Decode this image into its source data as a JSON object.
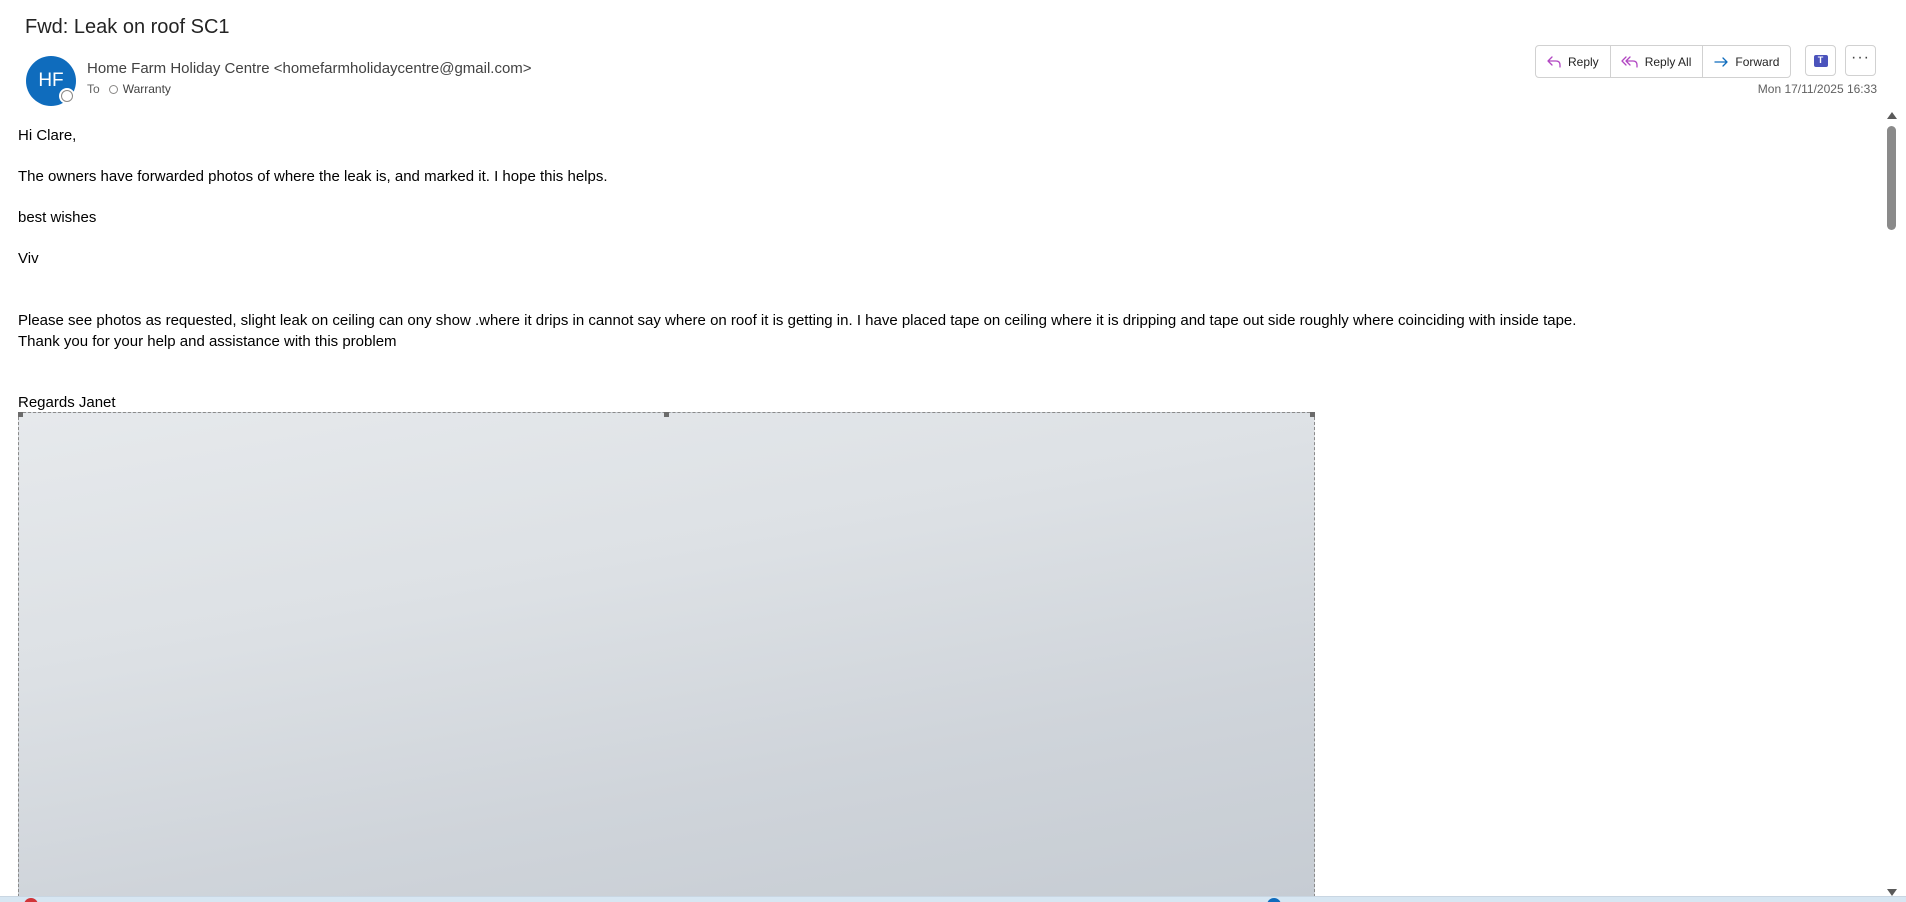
{
  "email": {
    "subject": "Fwd: Leak on roof SC1",
    "avatar_initials": "HF",
    "sender": "Home Farm Holiday Centre <homefarmholidaycentre@gmail.com>",
    "to_label": "To",
    "recipient": "Warranty",
    "date": "Mon 17/11/2025 16:33"
  },
  "actions": {
    "reply": "Reply",
    "reply_all": "Reply All",
    "forward": "Forward",
    "teams_icon": "teams-icon",
    "more_icon": "more-options-icon"
  },
  "body": {
    "greeting": "Hi Clare,",
    "line1": "The owners have forwarded photos of where the leak is, and marked it. I hope this helps.",
    "signoff": "best wishes",
    "name": "Viv",
    "forwarded_line1": "Please see photos as requested, slight leak on ceiling can ony show .where it drips in cannot say where on roof it is getting in.  I have placed tape on ceiling  where it is dripping and tape out side roughly where coinciding with inside tape.",
    "forwarded_line2": "Thank you for your help and assistance with this problem",
    "regards": "Regards Janet"
  },
  "colors": {
    "avatar": "#0f6cbd",
    "reply_icon": "#b146c2",
    "forward_icon": "#0f6cbd"
  }
}
